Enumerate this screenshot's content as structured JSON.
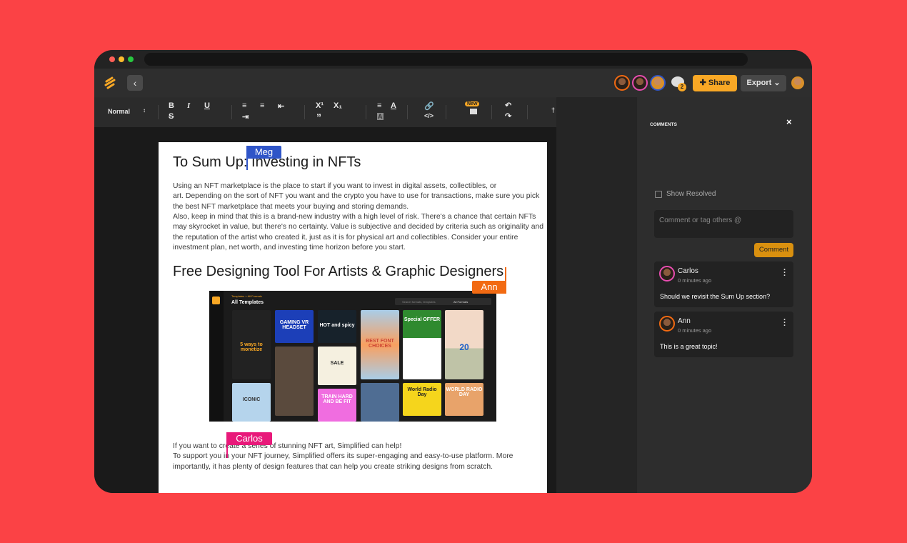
{
  "header": {
    "share_label": "Share",
    "export_label": "Export",
    "comment_count": "2"
  },
  "toolbar": {
    "style_select": "Normal",
    "new_badge": "New"
  },
  "document": {
    "heading1": "To Sum Up: Investing in NFTs",
    "para1": [
      "Using an NFT marketplace is the place to start if you want to invest in digital assets, collectibles, or",
      "art. Depending on the sort of NFT you want and the crypto you have to use for transactions, make sure you pick",
      "the best NFT marketplace that meets your buying and storing demands.",
      "Also, keep in mind that this is a brand-new industry with a high level of risk. There's a chance that certain NFTs",
      "may skyrocket in value, but there's no certainty. Value is subjective and decided by criteria such as originality and",
      "the reputation of the artist who created it, just as it is for physical art and collectibles. Consider your entire",
      "investment plan, net worth, and investing time horizon before you start."
    ],
    "heading2": "Free Designing Tool For Artists & Graphic Designers",
    "para2": [
      "If you want to create a series of stunning NFT art, Simplified can help!",
      "To support you in your NFT journey, Simplified offers its super-engaging and easy-to-use platform. More",
      "importantly, it has plenty of design features that can help you create striking designs from scratch."
    ],
    "embed": {
      "breadcrumb": "Templates > All Formats",
      "title": "All Templates",
      "search_placeholder": "Search formats, templates",
      "format_select": "All Formats",
      "tiles": [
        "5 ways to monetize",
        "GAMING VR HEADSET",
        "HOT and spicy",
        "BEST FONT CHOICES",
        "Special OFFER",
        "20",
        "SALE",
        "TRAIN HARD AND BE FIT",
        "World Radio Day",
        "WORLD RADIO DAY",
        "ICONIC"
      ]
    }
  },
  "cursors": [
    {
      "name": "Meg",
      "color": "#2f55c8"
    },
    {
      "name": "Ann",
      "color": "#f26a12"
    },
    {
      "name": "Carlos",
      "color": "#e8197a"
    }
  ],
  "comments_panel": {
    "title": "COMMENTS",
    "show_resolved": "Show Resolved",
    "input_placeholder": "Comment or tag others @",
    "submit_label": "Comment",
    "comments": [
      {
        "author": "Carlos",
        "time": "0 minutes ago",
        "text": "Should we revisit the Sum Up section?"
      },
      {
        "author": "Ann",
        "time": "0 minutes ago",
        "text": "This is a great topic!"
      }
    ]
  },
  "colors": {
    "background": "#fb4245",
    "accent": "#f9a825"
  }
}
